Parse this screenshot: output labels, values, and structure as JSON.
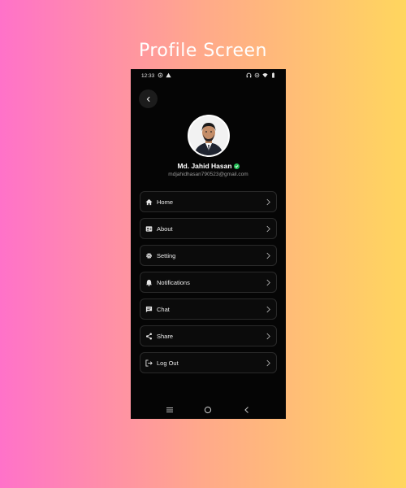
{
  "page": {
    "title": "Profile Screen"
  },
  "status_bar": {
    "time": "12:33",
    "left_icons": [
      "screen-record-icon",
      "warning-icon"
    ],
    "right_icons": [
      "headphones-icon",
      "hotspot-icon",
      "wifi-icon",
      "battery-icon"
    ]
  },
  "profile": {
    "name": "Md. Jahid Hasan",
    "email": "mdjahidhasan790523@gmail.com",
    "verified": true
  },
  "menu": [
    {
      "label": "Home",
      "icon": "home-icon"
    },
    {
      "label": "About",
      "icon": "contact-card-icon"
    },
    {
      "label": "Setting",
      "icon": "gear-icon"
    },
    {
      "label": "Notifications",
      "icon": "bell-icon"
    },
    {
      "label": "Chat",
      "icon": "chat-icon"
    },
    {
      "label": "Share",
      "icon": "share-icon"
    },
    {
      "label": "Log Out",
      "icon": "logout-icon"
    }
  ],
  "nav_bar": [
    "recent-apps-icon",
    "home-circle-icon",
    "back-icon"
  ],
  "colors": {
    "screen_bg": "#050505",
    "card_border": "#2a2a2a",
    "verified": "#27c15a",
    "gradient_start": "#ff72c9",
    "gradient_end": "#ffd65e"
  }
}
